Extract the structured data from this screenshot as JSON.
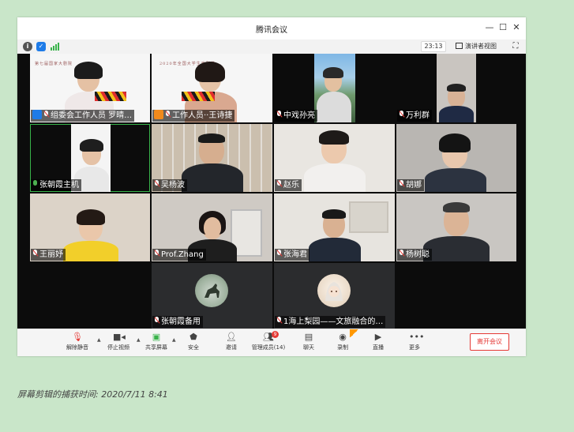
{
  "window": {
    "title": "腾讯会议"
  },
  "infobar": {
    "timer": "23:13",
    "speaker_view_label": "演讲者视图"
  },
  "participants": [
    {
      "name": "组委会工作人员 罗晴…"
    },
    {
      "name": "工作人员··王诗捷"
    },
    {
      "name": "中戏孙亮"
    },
    {
      "name": "万利群"
    },
    {
      "name": "张朝霞主机"
    },
    {
      "name": "吴杨波"
    },
    {
      "name": "赵乐"
    },
    {
      "name": "胡娜"
    },
    {
      "name": "王丽妤"
    },
    {
      "name": "Prof.Zhang"
    },
    {
      "name": "张海君"
    },
    {
      "name": "杨树聪"
    },
    {
      "name": "张朝霞备用"
    },
    {
      "name": "1海上梨园——文旅融合的…"
    }
  ],
  "toolbar": {
    "unmute": "解除静音",
    "stop_video": "停止视频",
    "share_screen": "共享屏幕",
    "security": "安全",
    "invite": "邀请",
    "manage_members": "管理成员(14)",
    "members_badge": "9",
    "chat": "聊天",
    "record": "录制",
    "live": "直播",
    "more": "更多",
    "leave": "离开会议"
  },
  "caption": "屏幕剪辑的捕获时间: 2020/7/11 8:41",
  "colors": {
    "accent_green": "#38b34a",
    "leave_red": "#e53935",
    "page_bg": "#c9e6c9"
  }
}
